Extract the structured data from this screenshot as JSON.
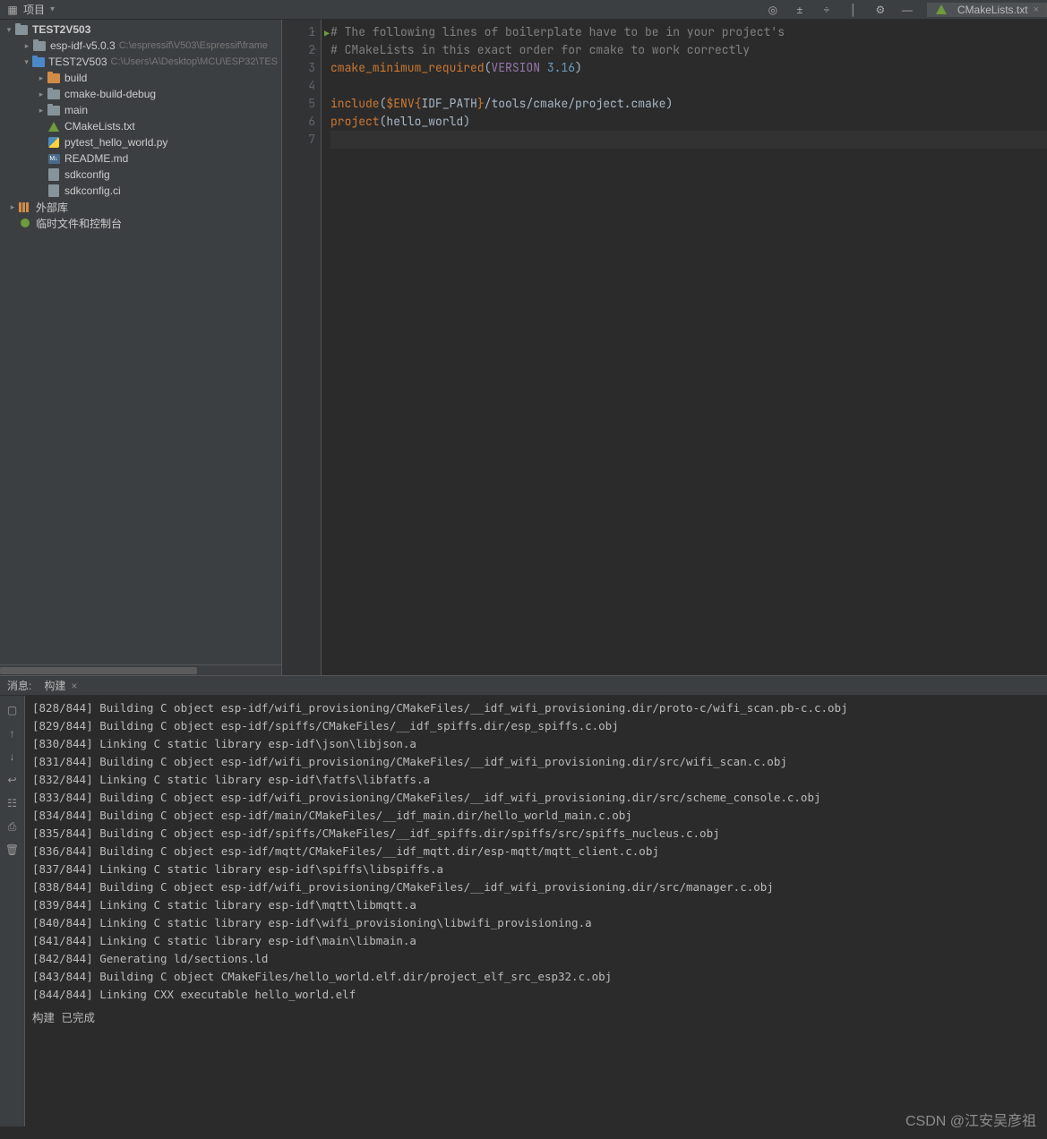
{
  "toolwindow": {
    "title": "项目",
    "icons": [
      "target-icon",
      "select-icon",
      "expand-icon",
      "collapse-icon",
      "gear-icon",
      "hide-icon"
    ]
  },
  "tree": {
    "root": {
      "label": "TEST2V503"
    },
    "items": [
      {
        "indent": 1,
        "arrow": "right",
        "icon": "folder",
        "label": "esp-idf-v5.0.3",
        "path": "C:\\espressif\\V503\\Espressif\\frame"
      },
      {
        "indent": 1,
        "arrow": "down",
        "icon": "folder-blue",
        "label": "TEST2V503",
        "path": "C:\\Users\\A\\Desktop\\MCU\\ESP32\\TES"
      },
      {
        "indent": 2,
        "arrow": "right",
        "icon": "folder-orange",
        "label": "build"
      },
      {
        "indent": 2,
        "arrow": "right",
        "icon": "folder",
        "label": "cmake-build-debug"
      },
      {
        "indent": 2,
        "arrow": "right",
        "icon": "folder",
        "label": "main"
      },
      {
        "indent": 2,
        "arrow": "",
        "icon": "cmake",
        "label": "CMakeLists.txt"
      },
      {
        "indent": 2,
        "arrow": "",
        "icon": "py",
        "label": "pytest_hello_world.py"
      },
      {
        "indent": 2,
        "arrow": "",
        "icon": "md",
        "label": "README.md"
      },
      {
        "indent": 2,
        "arrow": "",
        "icon": "file",
        "label": "sdkconfig"
      },
      {
        "indent": 2,
        "arrow": "",
        "icon": "file",
        "label": "sdkconfig.ci"
      },
      {
        "indent": 0,
        "arrow": "right",
        "icon": "lib",
        "label": "外部库"
      },
      {
        "indent": 0,
        "arrow": "",
        "icon": "green",
        "label": "临时文件和控制台"
      }
    ]
  },
  "editor": {
    "tab": "CMakeLists.txt",
    "lines": [
      {
        "n": 1,
        "segments": [
          {
            "t": "# The following lines of boilerplate have to be in your project's",
            "cls": "c-comment"
          }
        ]
      },
      {
        "n": 2,
        "segments": [
          {
            "t": "# CMakeLists in this exact order for cmake to work correctly",
            "cls": "c-comment"
          }
        ]
      },
      {
        "n": 3,
        "segments": [
          {
            "t": "cmake_minimum_required",
            "cls": "c-keyword"
          },
          {
            "t": "(",
            "cls": "c-paren"
          },
          {
            "t": "VERSION ",
            "cls": "c-var"
          },
          {
            "t": "3.16",
            "cls": "c-num"
          },
          {
            "t": ")",
            "cls": "c-paren"
          }
        ]
      },
      {
        "n": 4,
        "segments": []
      },
      {
        "n": 5,
        "segments": [
          {
            "t": "include",
            "cls": "c-keyword"
          },
          {
            "t": "(",
            "cls": "c-paren"
          },
          {
            "t": "$ENV{",
            "cls": "c-env"
          },
          {
            "t": "IDF_PATH",
            "cls": "c-ident"
          },
          {
            "t": "}",
            "cls": "c-env"
          },
          {
            "t": "/tools/cmake/project.cmake",
            "cls": "c-ident"
          },
          {
            "t": ")",
            "cls": "c-paren"
          }
        ]
      },
      {
        "n": 6,
        "segments": [
          {
            "t": "project",
            "cls": "c-keyword"
          },
          {
            "t": "(",
            "cls": "c-paren"
          },
          {
            "t": "hello_world",
            "cls": "c-ident"
          },
          {
            "t": ")",
            "cls": "c-paren"
          }
        ]
      },
      {
        "n": 7,
        "segments": [],
        "current": true
      }
    ]
  },
  "messages": {
    "header_label": "消息:",
    "tab": "构建",
    "status": "构建 已完成",
    "lines": [
      "[828/844] Building C object esp-idf/wifi_provisioning/CMakeFiles/__idf_wifi_provisioning.dir/proto-c/wifi_scan.pb-c.c.obj",
      "[829/844] Building C object esp-idf/spiffs/CMakeFiles/__idf_spiffs.dir/esp_spiffs.c.obj",
      "[830/844] Linking C static library esp-idf\\json\\libjson.a",
      "[831/844] Building C object esp-idf/wifi_provisioning/CMakeFiles/__idf_wifi_provisioning.dir/src/wifi_scan.c.obj",
      "[832/844] Linking C static library esp-idf\\fatfs\\libfatfs.a",
      "[833/844] Building C object esp-idf/wifi_provisioning/CMakeFiles/__idf_wifi_provisioning.dir/src/scheme_console.c.obj",
      "[834/844] Building C object esp-idf/main/CMakeFiles/__idf_main.dir/hello_world_main.c.obj",
      "[835/844] Building C object esp-idf/spiffs/CMakeFiles/__idf_spiffs.dir/spiffs/src/spiffs_nucleus.c.obj",
      "[836/844] Building C object esp-idf/mqtt/CMakeFiles/__idf_mqtt.dir/esp-mqtt/mqtt_client.c.obj",
      "[837/844] Linking C static library esp-idf\\spiffs\\libspiffs.a",
      "[838/844] Building C object esp-idf/wifi_provisioning/CMakeFiles/__idf_wifi_provisioning.dir/src/manager.c.obj",
      "[839/844] Linking C static library esp-idf\\mqtt\\libmqtt.a",
      "[840/844] Linking C static library esp-idf\\wifi_provisioning\\libwifi_provisioning.a",
      "[841/844] Linking C static library esp-idf\\main\\libmain.a",
      "[842/844] Generating ld/sections.ld",
      "[843/844] Building C object CMakeFiles/hello_world.elf.dir/project_elf_src_esp32.c.obj",
      "[844/844] Linking CXX executable hello_world.elf"
    ]
  },
  "watermark": "CSDN @江安吴彦祖"
}
